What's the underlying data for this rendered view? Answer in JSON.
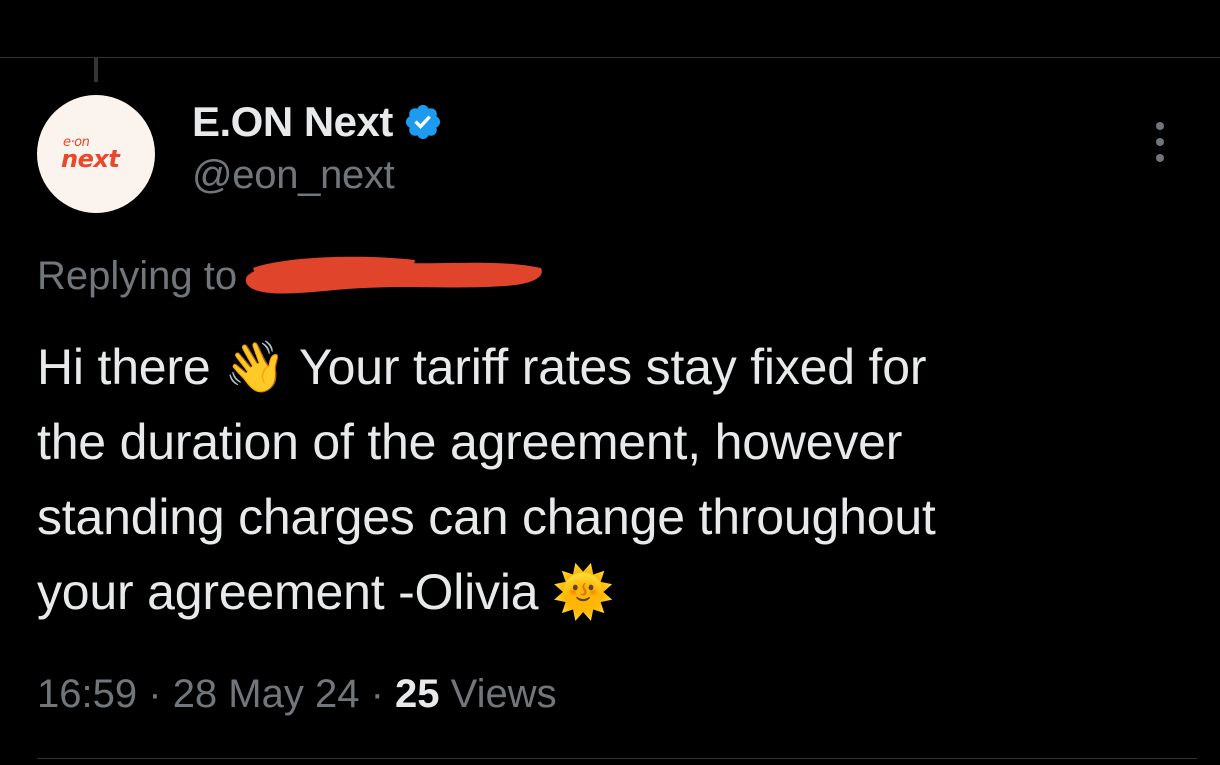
{
  "author": {
    "display_name": "E.ON Next",
    "handle": "@eon_next",
    "verified": true,
    "avatar_logo_small": "e·on",
    "avatar_logo_big": "next"
  },
  "reply": {
    "prefix": "Replying to"
  },
  "tweet": {
    "line1_a": "Hi there",
    "emoji_wave": "👋",
    "line1_b": "Your tariff rates stay fixed for",
    "line2": "the duration of the agreement, however",
    "line3": "standing charges can change throughout",
    "line4": "your agreement -Olivia",
    "emoji_sun": "🌞"
  },
  "meta": {
    "time": "16:59",
    "date": "28 May 24",
    "views_count": "25",
    "views_label": "Views",
    "separator": "·"
  },
  "colors": {
    "background": "#000000",
    "text_primary": "#e7e9ea",
    "text_secondary": "#71767b",
    "verified_blue": "#1d9bf0",
    "brand_red": "#e8482b",
    "redaction_red": "#e0452c"
  },
  "icons": {
    "verified": "verified-badge-icon",
    "more": "more-vertical-icon"
  }
}
